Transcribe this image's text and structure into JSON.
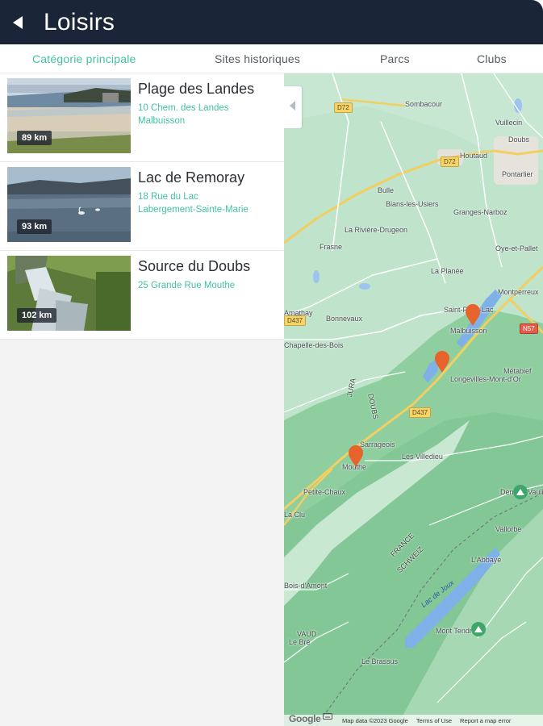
{
  "header": {
    "back_icon": "back-arrow-icon",
    "title": "Loisirs"
  },
  "tabs": [
    {
      "label": "Catégorie principale",
      "active": true
    },
    {
      "label": "Sites historiques",
      "active": false
    },
    {
      "label": "Parcs",
      "active": false
    },
    {
      "label": "Clubs",
      "active": false
    }
  ],
  "places": [
    {
      "title": "Plage des Landes",
      "address_line1": "10 Chem. des Landes",
      "address_line2": "Malbuisson",
      "distance": "89 km"
    },
    {
      "title": "Lac de Remoray",
      "address_line1": "18 Rue du Lac",
      "address_line2": "Labergement-Sainte-Marie",
      "distance": "93 km"
    },
    {
      "title": "Source du Doubs",
      "address_line1": "25 Grande Rue Mouthe",
      "address_line2": "",
      "distance": "102 km"
    }
  ],
  "map": {
    "labels": {
      "sombacour": "Sombacour",
      "vuillecin": "Vuillecin",
      "houtaud": "Houtaud",
      "doubs_town": "Doubs",
      "pontarlier": "Pontarlier",
      "bulle": "Bulle",
      "bians": "Bians-les-Usiers",
      "granges": "Granges-Narboz",
      "la_riviere": "La Rivière-Drugeon",
      "frasne": "Frasne",
      "oye": "Oye-et-Pallet",
      "la_planee": "La Planée",
      "montperreux": "Montperreux",
      "saint_point": "Saint-Point-Lac",
      "malbuisson": "Malbuisson",
      "bonnevaux": "Bonnevaux",
      "metabief": "Métabief",
      "jura": "JURA",
      "doubs_dept": "DOUBS",
      "longevilles": "Longevilles-Mont-d'Or",
      "sarrageois": "Sarrageois",
      "les_villedieu": "Les Villedieu",
      "mouthe": "Mouthe",
      "petite_chaux": "Petite-Chaux",
      "la_cluse": "La Clu",
      "dent_vaulion": "Dent de Vaulion",
      "france": "FRANCE",
      "schweiz": "SCHWEIZ",
      "labbaye": "L'Abbaye",
      "lac_de_joux": "Lac de Joux",
      "mont_tendre": "Mont Tendre",
      "le_brassus": "Le Brassus",
      "vaud": "VAUD",
      "le_bas": "Le Bré",
      "chapelle": "Chapelle-des-Bois",
      "bois_d_amont": "Bois-d'Amont",
      "vallorbe": "Vallorbe",
      "sombacour_w": "Amathay"
    },
    "roads": {
      "d72": "D72",
      "d72b": "D72",
      "d437": "D437",
      "n57": "N57",
      "d437b": "D437"
    },
    "pins_count": 3,
    "google_logo": "Google",
    "attribution": {
      "map_data": "Map data ©2023 Google",
      "terms": "Terms of Use",
      "report": "Report a map error"
    }
  }
}
